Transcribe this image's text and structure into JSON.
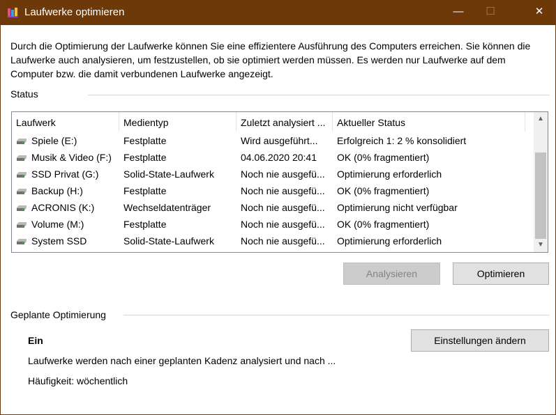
{
  "window": {
    "title": "Laufwerke optimieren",
    "minimize_glyph": "—",
    "maximize_glyph": "☐",
    "close_glyph": "✕"
  },
  "description": "Durch die Optimierung der Laufwerke können Sie eine effizientere Ausführung des Computers erreichen. Sie können die Laufwerke auch analysieren, um festzustellen, ob sie optimiert werden müssen. Es werden nur Laufwerke auf dem Computer bzw. die damit verbundenen Laufwerke angezeigt.",
  "status": {
    "label": "Status",
    "columns": [
      "Laufwerk",
      "Medientyp",
      "Zuletzt analysiert ...",
      "Aktueller Status"
    ],
    "rows": [
      {
        "drive": "Spiele (E:)",
        "media": "Festplatte",
        "last": "Wird ausgeführt...",
        "status": "Erfolgreich 1: 2 % konsolidiert"
      },
      {
        "drive": "Musik & Video (F:)",
        "media": "Festplatte",
        "last": "04.06.2020 20:41",
        "status": "OK (0% fragmentiert)"
      },
      {
        "drive": "SSD Privat (G:)",
        "media": "Solid-State-Laufwerk",
        "last": "Noch nie ausgefü...",
        "status": "Optimierung erforderlich"
      },
      {
        "drive": "Backup (H:)",
        "media": "Festplatte",
        "last": "Noch nie ausgefü...",
        "status": "OK (0% fragmentiert)"
      },
      {
        "drive": "ACRONIS (K:)",
        "media": "Wechseldatenträger",
        "last": "Noch nie ausgefü...",
        "status": "Optimierung nicht verfügbar"
      },
      {
        "drive": "Volume (M:)",
        "media": "Festplatte",
        "last": "Noch nie ausgefü...",
        "status": "OK (0% fragmentiert)"
      },
      {
        "drive": "System SSD",
        "media": "Solid-State-Laufwerk",
        "last": "Noch nie ausgefü...",
        "status": "Optimierung erforderlich"
      }
    ],
    "scroll_up_icon": "chevron-up-icon",
    "scroll_down_icon": "chevron-down-icon"
  },
  "actions": {
    "analyze_label": "Analysieren",
    "optimize_label": "Optimieren"
  },
  "schedule": {
    "label": "Geplante Optimierung",
    "state": "Ein",
    "description": "Laufwerke werden nach einer geplanten Kadenz analysiert und nach ...",
    "frequency": "Häufigkeit: wöchentlich",
    "settings_label": "Einstellungen ändern"
  },
  "colors": {
    "titlebar": "#6e3909",
    "scroll_thumb": "#c2c2c2"
  }
}
